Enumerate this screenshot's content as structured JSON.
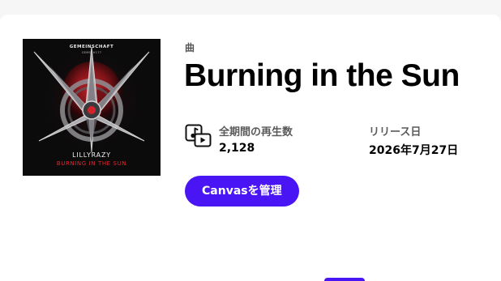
{
  "cover": {
    "brand": "GEMEINSCHAFT",
    "catalog": "GEMSCH177",
    "artist": "LILLYRAZY",
    "title": "BURNING IN THE SUN"
  },
  "track": {
    "type_label": "曲",
    "title": "Burning in the Sun"
  },
  "stats": {
    "plays_icon": "music-video-icon",
    "plays_label": "全期間の再生数",
    "plays_value": "2,128",
    "release_label": "リリース日",
    "release_value": "2026年7月27日"
  },
  "actions": {
    "canvas_button_label": "Canvasを管理"
  },
  "colors": {
    "accent": "#4a15f5",
    "cover_red": "#e8262b",
    "background": "#f6f6f6",
    "card": "#ffffff"
  }
}
